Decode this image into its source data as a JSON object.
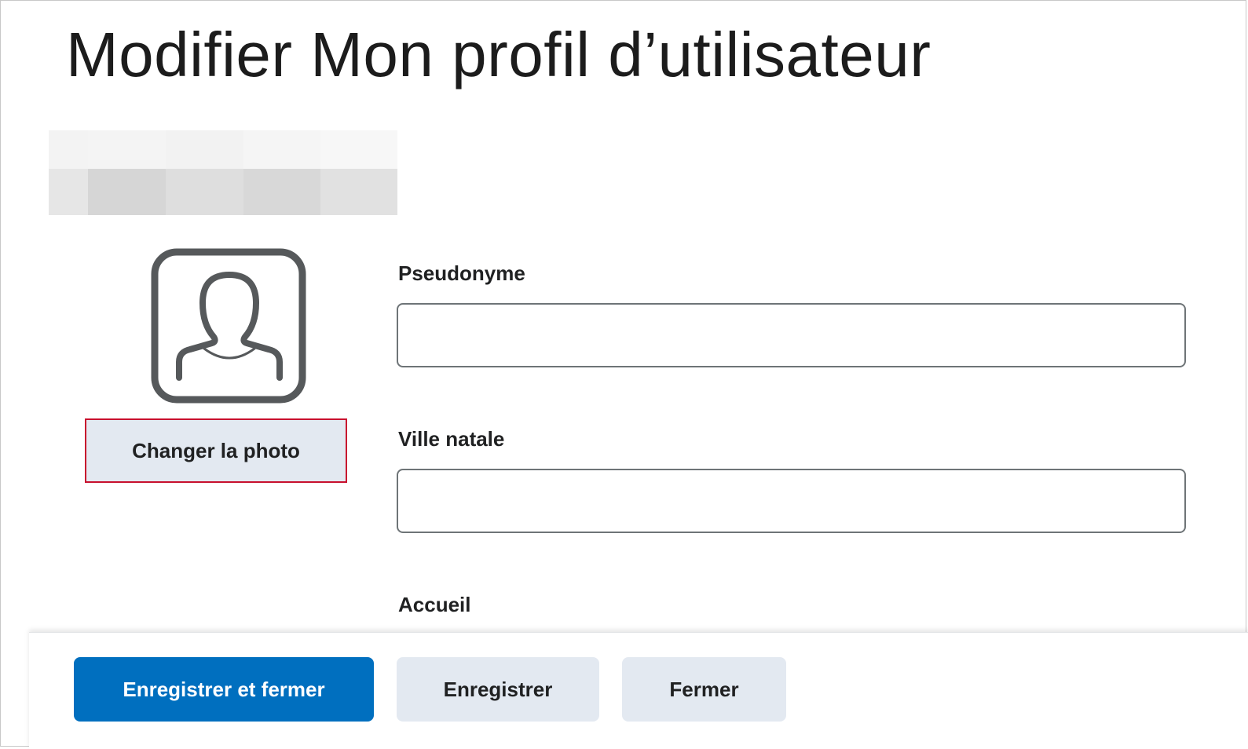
{
  "page": {
    "title": "Modifier Mon profil d’utilisateur"
  },
  "blurred_name": {
    "cells": [
      "#f3f3f3",
      "#f4f4f4",
      "#f2f2f2",
      "#f5f5f5",
      "#f7f7f7",
      "#e6e6e6",
      "#d6d6d6",
      "#dedede",
      "#d8d8d8",
      "#e1e1e1"
    ]
  },
  "profile": {
    "avatar_icon": "user-silhouette-icon",
    "change_photo_label": "Changer la photo",
    "highlight_color": "#c8102e"
  },
  "form": {
    "fields": [
      {
        "label": "Pseudonyme",
        "value": ""
      },
      {
        "label": "Ville natale",
        "value": ""
      },
      {
        "label": "Accueil",
        "value": ""
      }
    ]
  },
  "footer": {
    "save_close_label": "Enregistrer et fermer",
    "save_label": "Enregistrer",
    "close_label": "Fermer",
    "primary_color": "#006fbf",
    "secondary_color": "#e3e9f1"
  }
}
